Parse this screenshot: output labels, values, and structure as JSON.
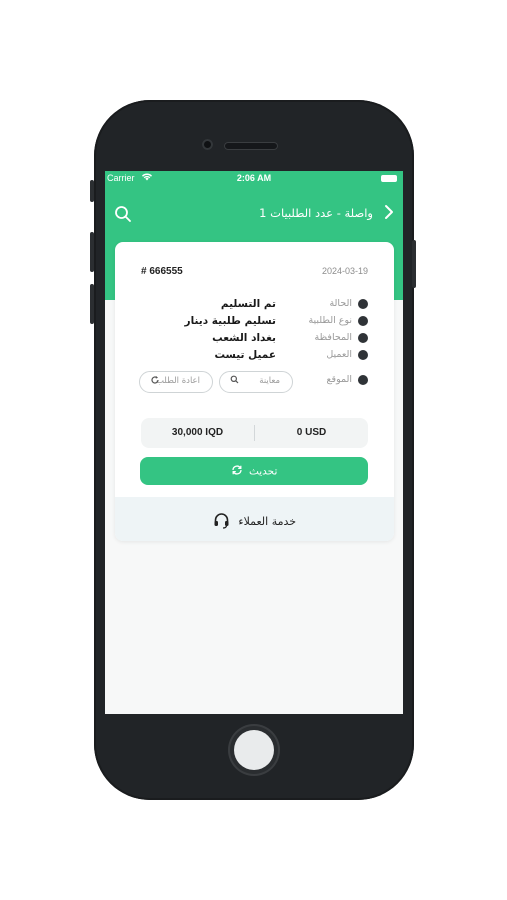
{
  "status_bar": {
    "carrier": "Carrier",
    "time": "2:06 AM"
  },
  "navbar": {
    "title": "واصلة - عدد الطلبيات 1"
  },
  "order": {
    "number": "# 666555",
    "date": "2024-03-19",
    "fields": [
      {
        "label": "الحالة",
        "value": "تم التسليم",
        "icon": "check-circle-icon"
      },
      {
        "label": "نوع الطلبية",
        "value": "تسليم طلبية دينار",
        "icon": "package-icon"
      },
      {
        "label": "المحافظة",
        "value": "بغداد الشعب",
        "icon": "location-pin-icon"
      },
      {
        "label": "العميل",
        "value": "عميل تيست",
        "icon": "user-icon"
      },
      {
        "label": "الموقع",
        "value": "",
        "icon": "map-icon"
      }
    ],
    "actions": {
      "preview": "معاينة",
      "reorder": "اعادة الطلب"
    },
    "amounts": {
      "iqd": "30,000 IQD",
      "usd": "0 USD"
    }
  },
  "refresh": {
    "label": "تحديث"
  },
  "support": {
    "label": "خدمة العملاء"
  },
  "colors": {
    "accent": "#34c483",
    "phone_body": "#212427"
  }
}
